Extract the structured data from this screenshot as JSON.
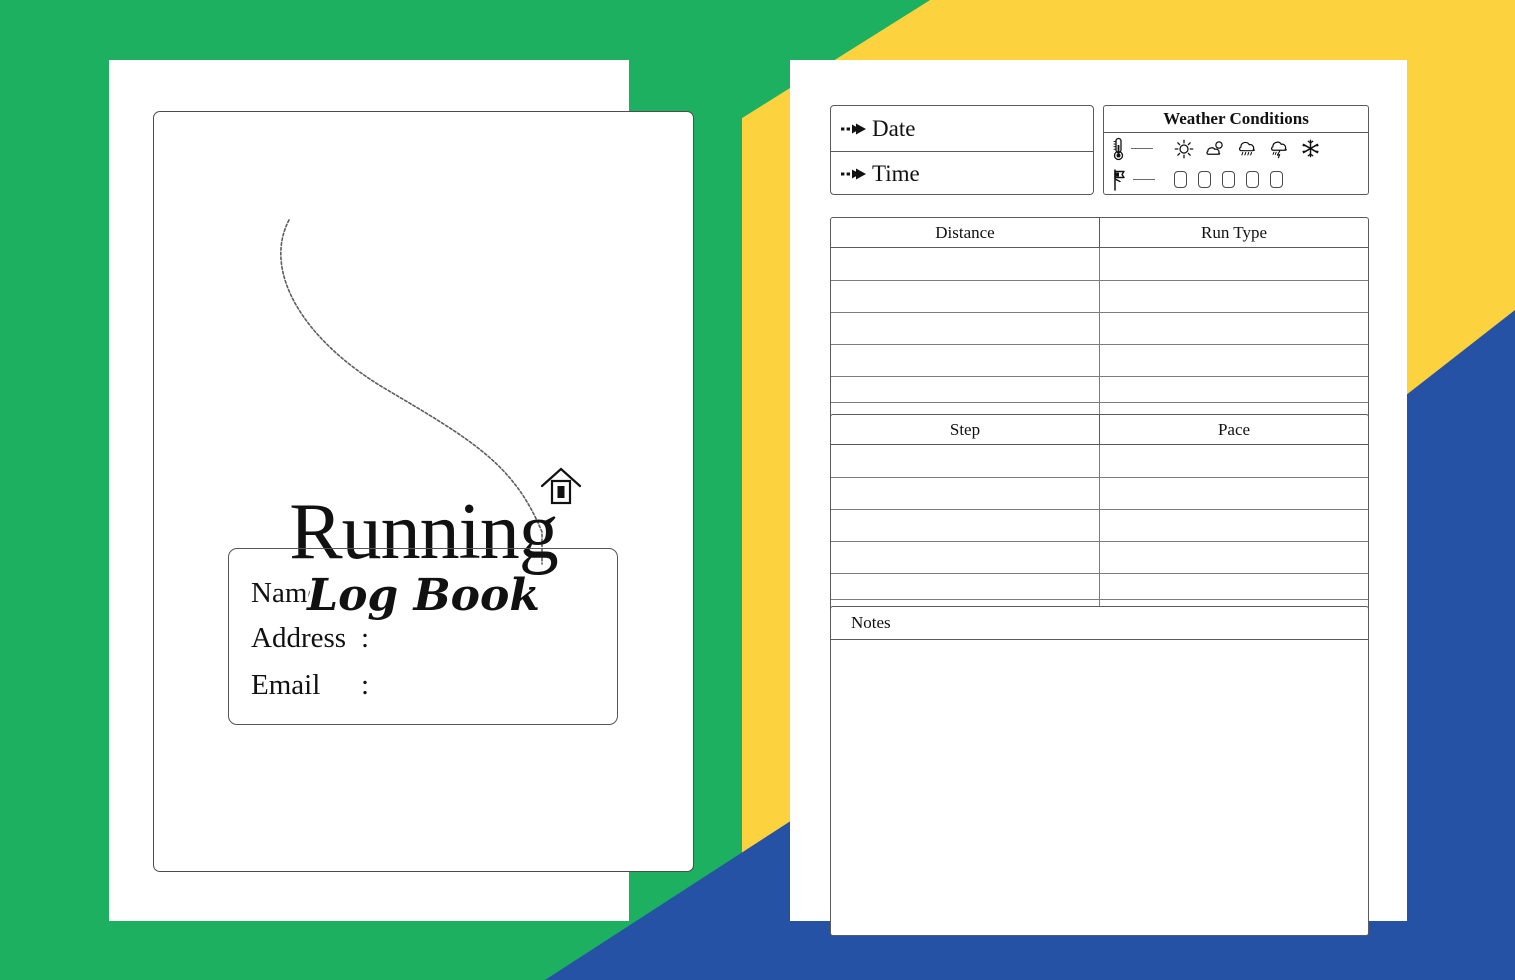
{
  "background": {
    "green": "#1db060",
    "yellow": "#fdd23f",
    "blue": "#2652a5",
    "white": "#ffffff"
  },
  "cover": {
    "title": "Running",
    "subtitle": "Log Book",
    "decor_curve_icon": "dotted-s-curve",
    "house_icon": "house-icon",
    "fields": [
      {
        "label": "Name",
        "colon": ":",
        "value": ""
      },
      {
        "label": "Address",
        "colon": ":",
        "value": ""
      },
      {
        "label": "Email",
        "colon": ":",
        "value": ""
      }
    ]
  },
  "log_page": {
    "date_time": {
      "arrow_icon": "dashed-arrow-right-icon",
      "rows": [
        {
          "label": "Date",
          "value": ""
        },
        {
          "label": "Time",
          "value": ""
        }
      ]
    },
    "weather": {
      "title": "Weather Conditions",
      "temperature_row": {
        "meta_icon": "thermometer-icon",
        "dash": "—",
        "options": [
          {
            "icon": "sun-icon",
            "name": "sunny"
          },
          {
            "icon": "partly-cloudy-icon",
            "name": "partly-cloudy"
          },
          {
            "icon": "rain-cloud-icon",
            "name": "rain"
          },
          {
            "icon": "storm-cloud-icon",
            "name": "storm"
          },
          {
            "icon": "snowflake-icon",
            "name": "snow"
          }
        ]
      },
      "wind_row": {
        "meta_icon": "windsock-flag-icon",
        "dash": "—",
        "checkbox_count": 5
      }
    },
    "tables": [
      {
        "id": "distance",
        "headers": [
          "Distance",
          "Run Type"
        ],
        "rows": [
          [
            "",
            ""
          ],
          [
            "",
            ""
          ],
          [
            "",
            ""
          ],
          [
            "",
            ""
          ],
          [
            "",
            ""
          ],
          [
            "",
            ""
          ]
        ]
      },
      {
        "id": "step",
        "headers": [
          "Step",
          "Pace"
        ],
        "rows": [
          [
            "",
            ""
          ],
          [
            "",
            ""
          ],
          [
            "",
            ""
          ],
          [
            "",
            ""
          ],
          [
            "",
            ""
          ],
          [
            "",
            ""
          ]
        ]
      }
    ],
    "notes": {
      "title": "Notes",
      "value": ""
    }
  }
}
